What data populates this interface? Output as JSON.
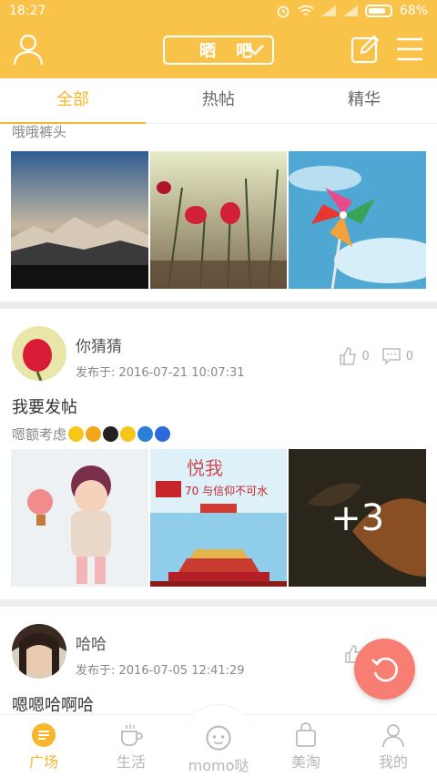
{
  "status": {
    "time": "18:27",
    "battery": "68%"
  },
  "header": {
    "title": "晒 吧"
  },
  "tabs": [
    {
      "label": "全部",
      "active": true
    },
    {
      "label": "热帖",
      "active": false
    },
    {
      "label": "精华",
      "active": false
    }
  ],
  "posts": [
    {
      "partial_text": "哦哦裤头"
    },
    {
      "username": "你猜猜",
      "time": "发布于: 2016-07-21 10:07:31",
      "likes": "0",
      "comments": "0",
      "title": "我要发帖",
      "subtitle": "嗯额考虑",
      "more_images": "+3"
    },
    {
      "username": "哈哈",
      "time": "发布于: 2016-07-05 12:41:29",
      "title": "嗯嗯哈啊哈"
    }
  ],
  "bottom_nav": [
    {
      "label": "广场",
      "active": true
    },
    {
      "label": "生活",
      "active": false
    },
    {
      "label": "momo哒",
      "active": false
    },
    {
      "label": "美淘",
      "active": false
    },
    {
      "label": "我的",
      "active": false
    }
  ],
  "colors": {
    "accent": "#f9c34a",
    "active_text": "#f7b62c",
    "fab": "#f87e74"
  }
}
